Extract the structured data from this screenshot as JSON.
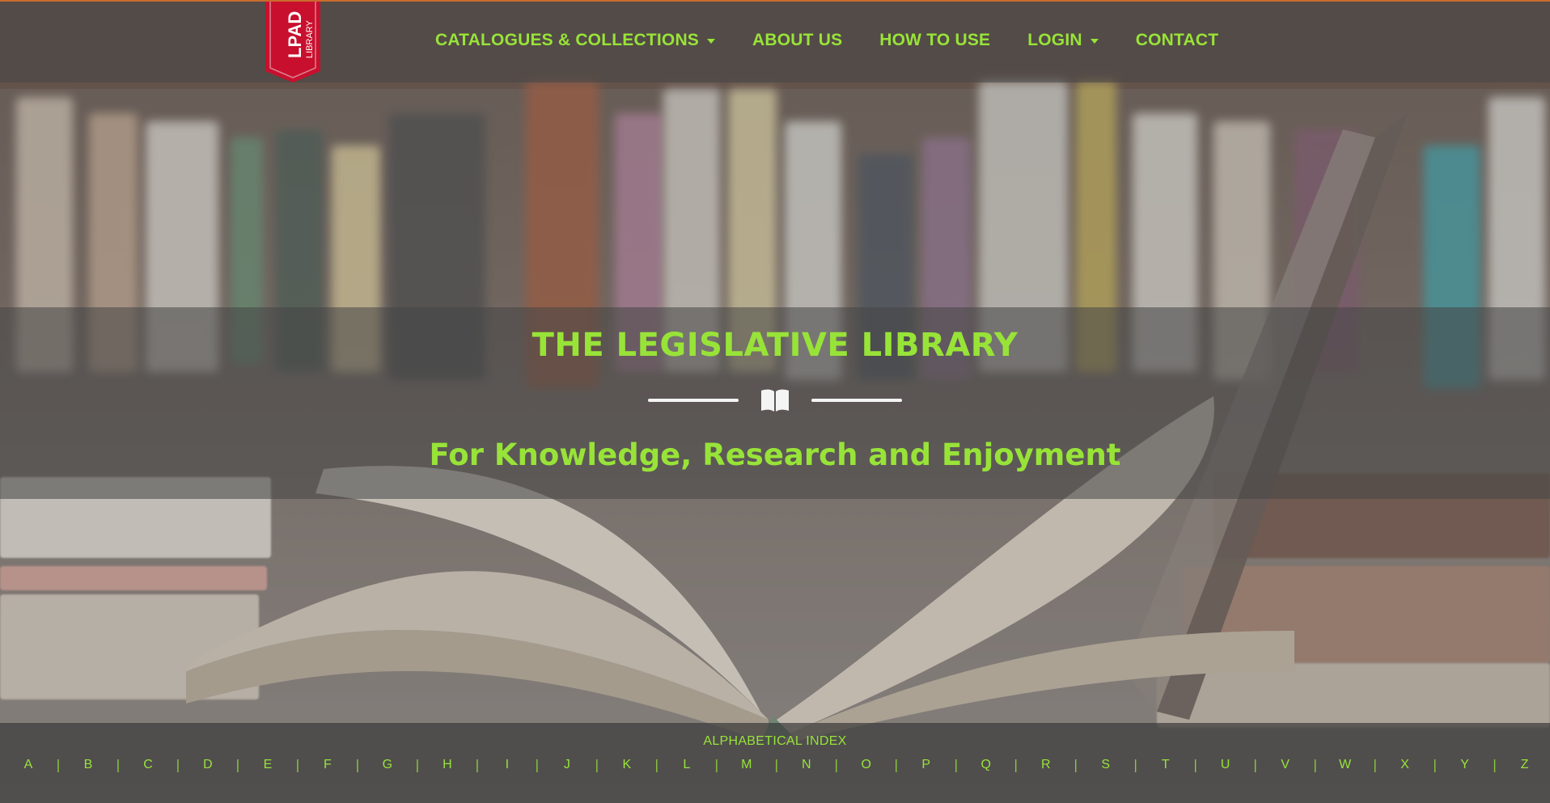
{
  "brand": {
    "logo_main": "LPAD",
    "logo_sub": "LIBRARY",
    "logo_color": "#c8102e"
  },
  "nav": {
    "items": [
      {
        "label": "CATALOGUES & COLLECTIONS",
        "has_dropdown": true
      },
      {
        "label": "ABOUT US",
        "has_dropdown": false
      },
      {
        "label": "HOW TO USE",
        "has_dropdown": false
      },
      {
        "label": "LOGIN",
        "has_dropdown": true
      },
      {
        "label": "CONTACT",
        "has_dropdown": false
      }
    ]
  },
  "hero": {
    "title": "THE LEGISLATIVE LIBRARY",
    "subtitle": "For Knowledge, Research and Enjoyment",
    "divider_icon": "open-book-icon"
  },
  "index": {
    "title": "ALPHABETICAL INDEX",
    "letters": [
      "A",
      "B",
      "C",
      "D",
      "E",
      "F",
      "G",
      "H",
      "I",
      "J",
      "K",
      "L",
      "M",
      "N",
      "O",
      "P",
      "Q",
      "R",
      "S",
      "T",
      "U",
      "V",
      "W",
      "X",
      "Y",
      "Z"
    ]
  },
  "colors": {
    "accent": "#98e338",
    "topline": "#c96a2c"
  }
}
